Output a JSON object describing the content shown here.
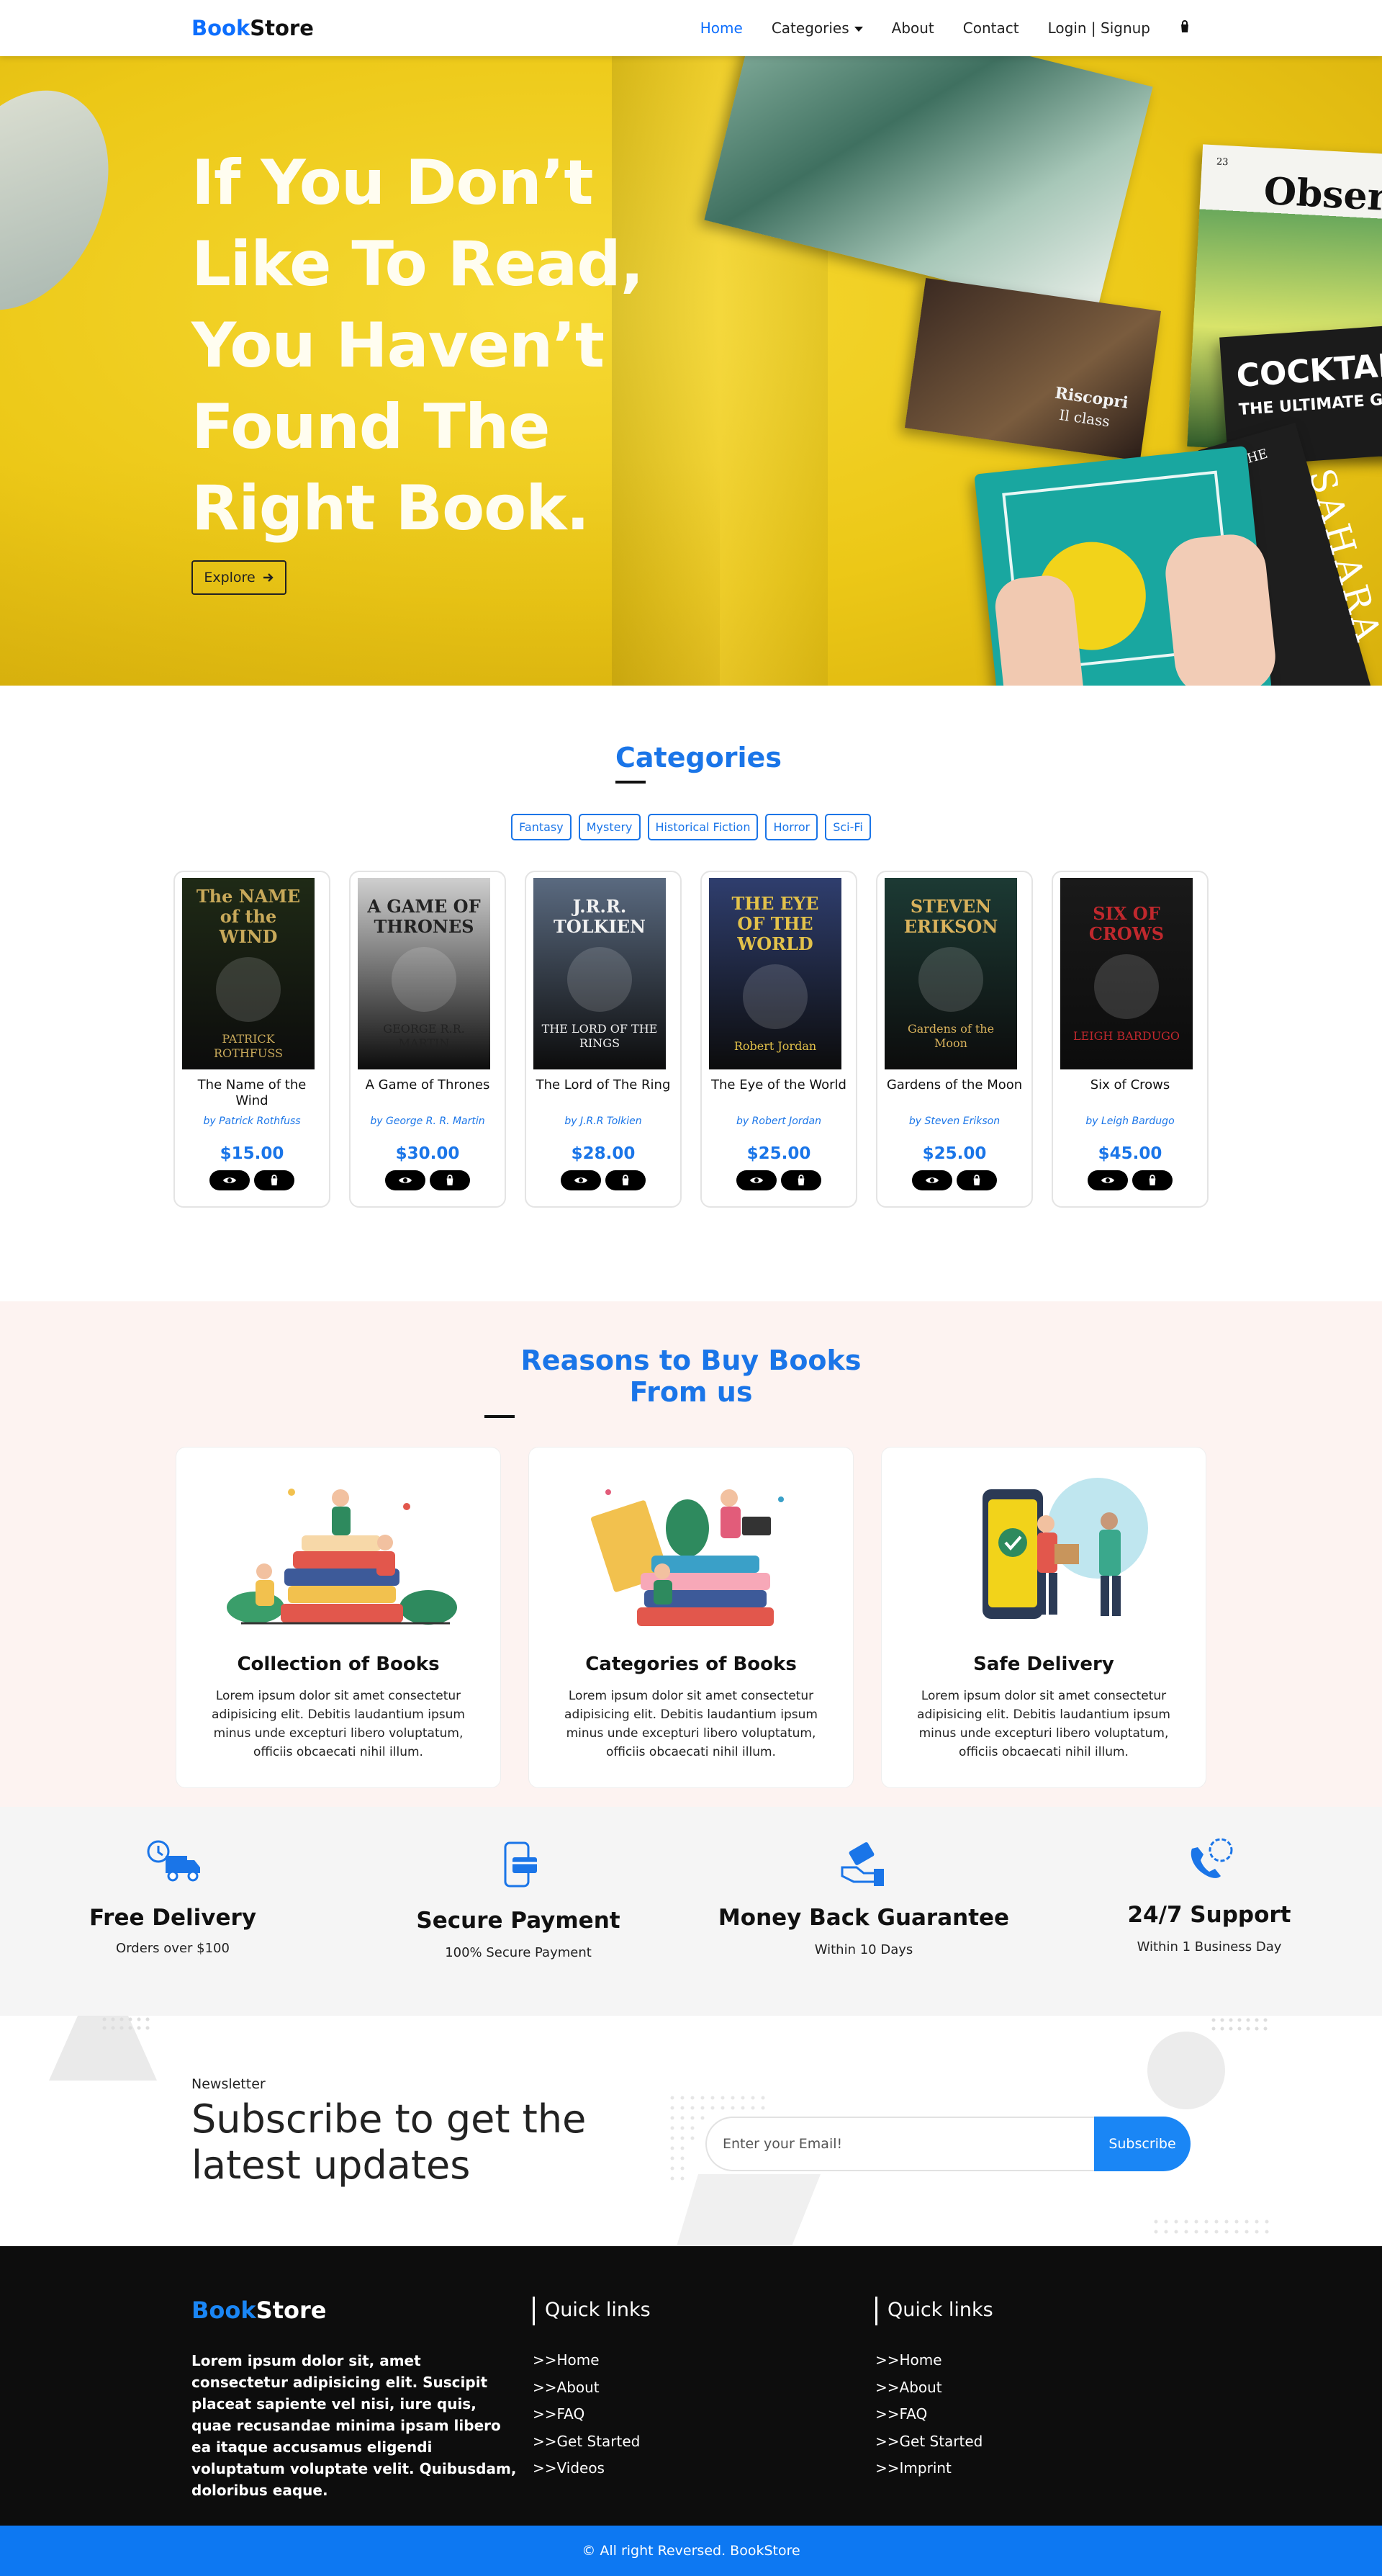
{
  "nav": {
    "logo_a": "Book",
    "logo_b": "Store",
    "links": [
      "Home",
      "Categories",
      "About",
      "Contact",
      "Login | Signup"
    ]
  },
  "hero": {
    "headline_lines": [
      "If You Don’t",
      "Like To Read,",
      "You Haven’t",
      "Found The",
      "Right Book."
    ],
    "explore": "Explore",
    "magazine_texts": [
      "Observ",
      "COCKTAI",
      "THE ULTIMATE GU",
      "THE",
      "SAHARA",
      "Riscopri",
      "Il class",
      "23"
    ]
  },
  "categories": {
    "title": "Categories",
    "filters": [
      "Fantasy",
      "Mystery",
      "Historical Fiction",
      "Horror",
      "Sci-Fi"
    ],
    "books": [
      {
        "title": "The Name of the Wind",
        "by": "by",
        "author": "Patrick Rothfuss",
        "price": "$15.00",
        "cover": {
          "top": "The NAME of the WIND",
          "bottom": "PATRICK ROTHFUSS",
          "bg": "#1f2a16",
          "fg": "#c8a95a"
        }
      },
      {
        "title": "A Game of Thrones",
        "by": "by",
        "author": "George R. R. Martin",
        "price": "$30.00",
        "cover": {
          "top": "A GAME OF THRONES",
          "bottom": "GEORGE R.R. MARTIN",
          "bg": "#cfcfcf",
          "fg": "#222222"
        }
      },
      {
        "title": "The Lord of The Ring",
        "by": "by",
        "author": "J.R.R Tolkien",
        "price": "$28.00",
        "cover": {
          "top": "J.R.R. TOLKIEN",
          "bottom": "THE LORD OF THE RINGS",
          "bg": "#5a6a80",
          "fg": "#f2f2f2"
        }
      },
      {
        "title": "The Eye of the World",
        "by": "by",
        "author": "Robert Jordan",
        "price": "$25.00",
        "cover": {
          "top": "THE EYE OF THE WORLD",
          "bottom": "Robert Jordan",
          "bg": "#2f3e6e",
          "fg": "#e3c24a"
        }
      },
      {
        "title": "Gardens of the Moon",
        "by": "by",
        "author": "Steven Erikson",
        "price": "$25.00",
        "cover": {
          "top": "STEVEN ERIKSON",
          "bottom": "Gardens of the Moon",
          "bg": "#1c3a34",
          "fg": "#d9b25c"
        }
      },
      {
        "title": "Six of Crows",
        "by": "by",
        "author": "Leigh Bardugo",
        "price": "$45.00",
        "cover": {
          "top": "SIX OF CROWS",
          "bottom": "LEIGH BARDUGO",
          "bg": "#1a1a1a",
          "fg": "#c0282d"
        }
      }
    ]
  },
  "reasons": {
    "title": "Reasons to Buy Books From us",
    "cards": [
      {
        "heading": "Collection of Books",
        "text": "Lorem ipsum dolor sit amet consectetur adipisicing elit. Debitis laudantium ipsum minus unde excepturi libero voluptatum, officiis obcaecati nihil illum."
      },
      {
        "heading": "Categories of Books",
        "text": "Lorem ipsum dolor sit amet consectetur adipisicing elit. Debitis laudantium ipsum minus unde excepturi libero voluptatum, officiis obcaecati nihil illum."
      },
      {
        "heading": "Safe Delivery",
        "text": "Lorem ipsum dolor sit amet consectetur adipisicing elit. Debitis laudantium ipsum minus unde excepturi libero voluptatum, officiis obcaecati nihil illum."
      }
    ]
  },
  "features": [
    {
      "title": "Free Delivery",
      "sub": "Orders over $100",
      "icon": "delivery-truck-icon"
    },
    {
      "title": "Secure Payment",
      "sub": "100% Secure Payment",
      "icon": "phone-card-icon"
    },
    {
      "title": "Money Back Guarantee",
      "sub": "Within 10 Days",
      "icon": "money-hand-icon"
    },
    {
      "title": "24/7 Support",
      "sub": "Within 1 Business Day",
      "icon": "phone-24-icon"
    }
  ],
  "newsletter": {
    "label": "Newsletter",
    "title_line1": "Subscribe to get the",
    "title_line2": "latest updates",
    "placeholder": "Enter your Email!",
    "button": "Subscribe"
  },
  "footer": {
    "logo_a": "Book",
    "logo_b": "Store",
    "description": "Lorem ipsum dolor sit, amet consectetur adipisicing elit. Suscipit placeat sapiente vel nisi, iure quis, quae recusandae minima ipsam libero ea itaque accusamus eligendi voluptatum voluptate velit. Quibusdam, doloribus eaque.",
    "col1": {
      "title": "Quick links",
      "items": [
        ">>Home",
        ">>About",
        ">>FAQ",
        ">>Get Started",
        ">>Videos"
      ]
    },
    "col2": {
      "title": "Quick links",
      "items": [
        ">>Home",
        ">>About",
        ">>FAQ",
        ">>Get Started",
        ">>Imprint"
      ]
    }
  },
  "bottom_bar": "© All right Reversed.  BookStore",
  "colors": {
    "accent": "#1a75e8",
    "hero_yellow": "#ecc817",
    "footer_bg": "#0d0d0d",
    "bottom_bar": "#0d78f2",
    "reasons_bg": "#fdf3f1"
  }
}
